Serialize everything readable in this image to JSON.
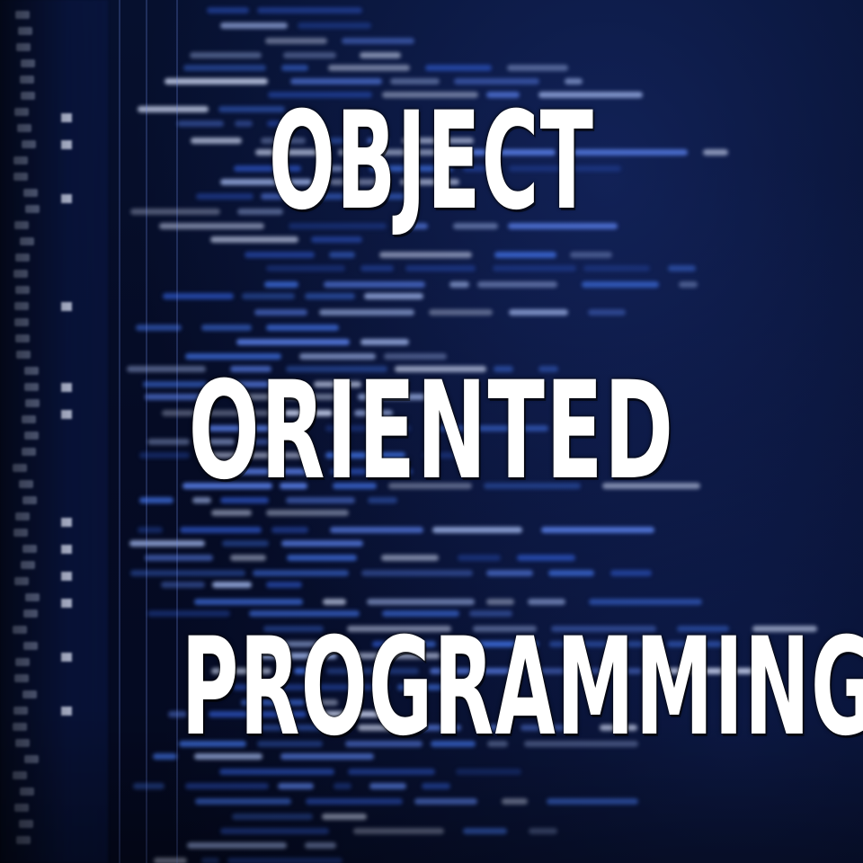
{
  "headline": {
    "line_1": "OBJECT",
    "line_2": "ORIENTED",
    "line_3": "PROGRAMMING"
  },
  "colors": {
    "background": "#040a1f",
    "code_blue": "#3f6fe0",
    "code_light": "#9fb4ea",
    "headline_text": "#ffffff"
  }
}
